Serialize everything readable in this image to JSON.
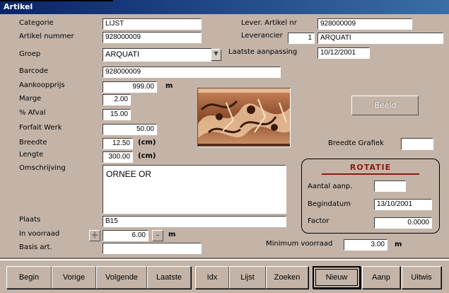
{
  "window": {
    "title": "Artikel"
  },
  "form": {
    "categorie": {
      "label": "Categorie",
      "value": "LIJST"
    },
    "artikel_nummer": {
      "label": "Artikel nummer",
      "value": "928000009"
    },
    "groep": {
      "label": "Groep",
      "value": "ARQUATI"
    },
    "barcode": {
      "label": "Barcode",
      "value": "928000009"
    },
    "aankoopprijs": {
      "label": "Aankoopprijs",
      "value": "999.00",
      "unit": "m"
    },
    "marge": {
      "label": "Marge",
      "value": "2.00"
    },
    "afval": {
      "label": "% Afval",
      "value": "15.00"
    },
    "forfait_werk": {
      "label": "Forfait Werk",
      "value": "50.00"
    },
    "breedte": {
      "label": "Breedte",
      "value": "12.50",
      "unit": "(cm)"
    },
    "lengte": {
      "label": "Lengte",
      "value": "300.00",
      "unit": "(cm)"
    },
    "omschrijving": {
      "label": "Omschrijving",
      "value": "ORNEE OR"
    },
    "plaats": {
      "label": "Plaats",
      "value": "B15"
    },
    "in_voorraad": {
      "label": "In voorraad",
      "value": "6.00",
      "unit": "m",
      "plus": "+",
      "minus": "-"
    },
    "basis_art": {
      "label": "Basis art.",
      "value": ""
    },
    "lever_artikel_nr": {
      "label": "Lever. Artikel nr",
      "value": "928000009"
    },
    "leverancier": {
      "label": "Leverancier",
      "code": "1",
      "name": "ARQUATI"
    },
    "laatste_aanpassing": {
      "label": "Laatste aanpassing",
      "value": "10/12/2001"
    },
    "beeld_button": "Beeld",
    "breedte_grafiek": {
      "label": "Breedte Grafiek",
      "value": ""
    },
    "minimum_voorraad": {
      "label": "Minimum voorraad",
      "value": "3.00",
      "unit": "m"
    }
  },
  "rotatie": {
    "title": "ROTATIE",
    "aantal_aanp": {
      "label": "Aantal aanp.",
      "value": ""
    },
    "begindatum": {
      "label": "Begindatum",
      "value": "13/10/2001"
    },
    "factor": {
      "label": "Factor",
      "value": "0.0000"
    }
  },
  "nav": {
    "begin": "Begin",
    "vorige": "Vorige",
    "volgende": "Volgende",
    "laatste": "Laatste",
    "idx": "Idx",
    "lijst": "Lijst",
    "zoeken": "Zoeken",
    "nieuw": "Nieuw",
    "aanp": "Aanp",
    "uitwis": "Uitwis"
  },
  "colors": {
    "background": "#c4b4a8",
    "title_bar": "#0a246a",
    "rotatie_accent": "#8b1a10"
  },
  "image": {
    "icon": "ornate-frame-molding-picture"
  }
}
